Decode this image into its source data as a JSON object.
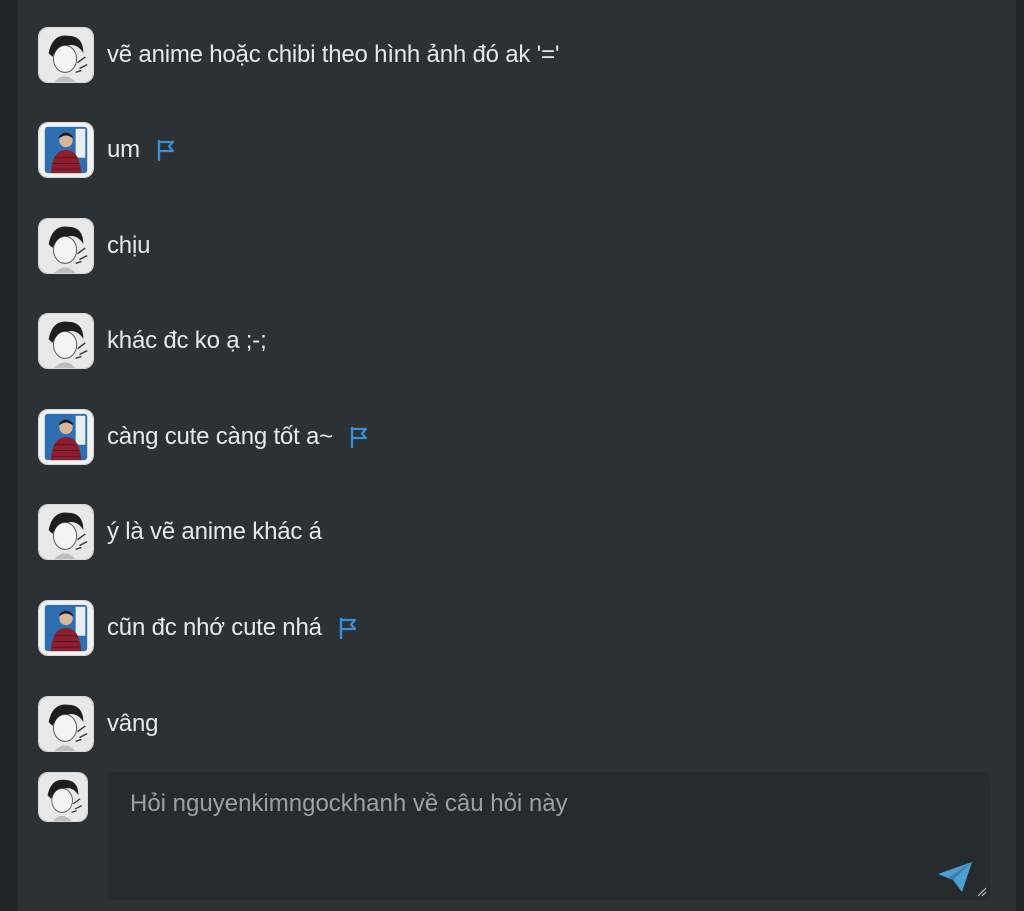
{
  "messages": [
    {
      "author": "asker",
      "text": "vẽ anime hoặc chibi theo hình ảnh đó ak '='",
      "flag": false
    },
    {
      "author": "answerer",
      "text": "um",
      "flag": true
    },
    {
      "author": "asker",
      "text": "chịu",
      "flag": false
    },
    {
      "author": "asker",
      "text": "khác đc ko ạ ;-;",
      "flag": false
    },
    {
      "author": "answerer",
      "text": "càng cute càng tốt a~",
      "flag": true
    },
    {
      "author": "asker",
      "text": "ý là vẽ anime khác á",
      "flag": false
    },
    {
      "author": "answerer",
      "text": "cũn đc nhớ cute nhá",
      "flag": true
    },
    {
      "author": "asker",
      "text": "vâng",
      "flag": false
    }
  ],
  "composer": {
    "placeholder": "Hỏi nguyenkimngockhanh về câu hỏi này",
    "value": ""
  },
  "icons": {
    "flag": "flag-icon",
    "send": "send-icon",
    "resize": "resize-grip-icon"
  },
  "colors": {
    "background": "#2b3135",
    "text": "#e6e9ea",
    "placeholder": "#9aa2a6",
    "flag": "#3a8fd6",
    "send": "#4f9ed1"
  }
}
